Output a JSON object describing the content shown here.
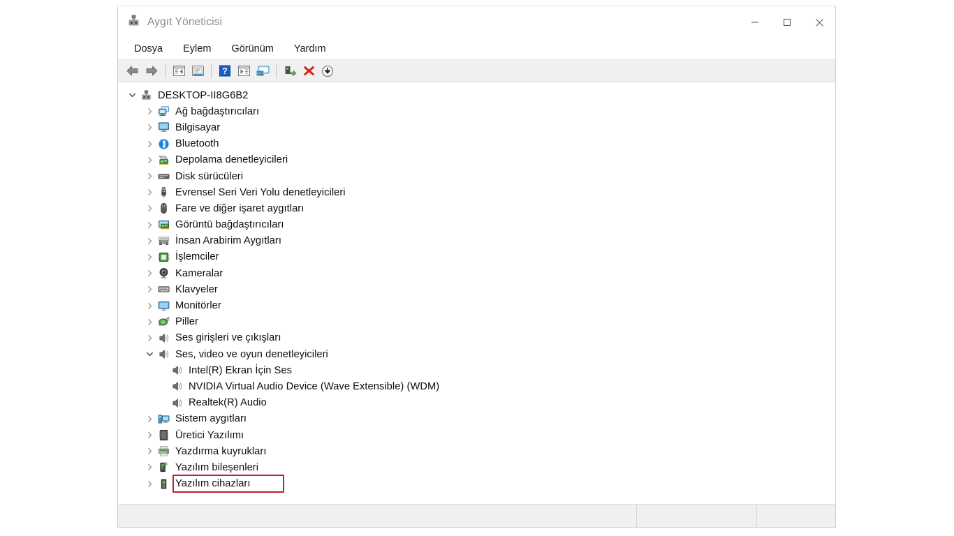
{
  "window": {
    "title": "Aygıt Yöneticisi",
    "icon": "device-manager-icon",
    "controls": {
      "minimize": "minimize-icon",
      "maximize": "maximize-icon",
      "close": "close-icon"
    }
  },
  "menubar": {
    "items": [
      {
        "label": "Dosya"
      },
      {
        "label": "Eylem"
      },
      {
        "label": "Görünüm"
      },
      {
        "label": "Yardım"
      }
    ]
  },
  "toolbar": {
    "buttons": [
      {
        "icon": "back-arrow-icon",
        "title": "Geri"
      },
      {
        "icon": "forward-arrow-icon",
        "title": "İleri"
      },
      {
        "icon": "separator"
      },
      {
        "icon": "properties-panel-icon",
        "title": "Özellikler"
      },
      {
        "icon": "help-document-icon",
        "title": "Yardım"
      },
      {
        "icon": "separator"
      },
      {
        "icon": "help-question-icon",
        "title": "Yardım"
      },
      {
        "icon": "show-hidden-devices-icon",
        "title": "Gizli aygıtları göster"
      },
      {
        "icon": "scan-hardware-icon",
        "title": "Donanım değişikliklerini tara"
      },
      {
        "icon": "separator"
      },
      {
        "icon": "update-driver-icon",
        "title": "Sürücüyü güncelle"
      },
      {
        "icon": "uninstall-device-icon",
        "title": "Aygıtı kaldır"
      },
      {
        "icon": "download-driver-icon",
        "title": "Sürücü indir"
      }
    ]
  },
  "tree": {
    "root": {
      "label": "DESKTOP-II8G6B2",
      "icon": "computer-root-icon",
      "expanded": true
    },
    "nodes": [
      {
        "label": "Ağ bağdaştırıcıları",
        "icon": "network-adapter-icon",
        "expanded": false,
        "depth": 1
      },
      {
        "label": "Bilgisayar",
        "icon": "computer-icon",
        "expanded": false,
        "depth": 1
      },
      {
        "label": "Bluetooth",
        "icon": "bluetooth-icon",
        "expanded": false,
        "depth": 1
      },
      {
        "label": "Depolama denetleyicileri",
        "icon": "storage-controller-icon",
        "expanded": false,
        "depth": 1
      },
      {
        "label": "Disk sürücüleri",
        "icon": "disk-drive-icon",
        "expanded": false,
        "depth": 1
      },
      {
        "label": "Evrensel Seri Veri Yolu denetleyicileri",
        "icon": "usb-controller-icon",
        "expanded": false,
        "depth": 1
      },
      {
        "label": "Fare ve diğer işaret aygıtları",
        "icon": "mouse-icon",
        "expanded": false,
        "depth": 1
      },
      {
        "label": "Görüntü bağdaştırıcıları",
        "icon": "display-adapter-icon",
        "expanded": false,
        "depth": 1
      },
      {
        "label": "İnsan Arabirim Aygıtları",
        "icon": "hid-device-icon",
        "expanded": false,
        "depth": 1
      },
      {
        "label": "İşlemciler",
        "icon": "processor-icon",
        "expanded": false,
        "depth": 1
      },
      {
        "label": "Kameralar",
        "icon": "camera-icon",
        "expanded": false,
        "depth": 1
      },
      {
        "label": "Klavyeler",
        "icon": "keyboard-icon",
        "expanded": false,
        "depth": 1
      },
      {
        "label": "Monitörler",
        "icon": "monitor-icon",
        "expanded": false,
        "depth": 1
      },
      {
        "label": "Piller",
        "icon": "battery-icon",
        "expanded": false,
        "depth": 1
      },
      {
        "label": "Ses girişleri ve çıkışları",
        "icon": "speaker-icon",
        "expanded": false,
        "depth": 1
      },
      {
        "label": "Ses, video ve oyun denetleyicileri",
        "icon": "speaker-icon",
        "expanded": true,
        "depth": 1
      },
      {
        "label": "Intel(R) Ekran İçin Ses",
        "icon": "speaker-icon",
        "expanded": null,
        "depth": 2
      },
      {
        "label": "NVIDIA Virtual Audio Device (Wave Extensible) (WDM)",
        "icon": "speaker-icon",
        "expanded": null,
        "depth": 2
      },
      {
        "label": "Realtek(R) Audio",
        "icon": "speaker-icon",
        "expanded": null,
        "depth": 2,
        "highlighted": true
      },
      {
        "label": "Sistem aygıtları",
        "icon": "system-device-icon",
        "expanded": false,
        "depth": 1
      },
      {
        "label": "Üretici Yazılımı",
        "icon": "firmware-icon",
        "expanded": false,
        "depth": 1
      },
      {
        "label": "Yazdırma kuyrukları",
        "icon": "print-queue-icon",
        "expanded": false,
        "depth": 1
      },
      {
        "label": "Yazılım bileşenleri",
        "icon": "software-component-icon",
        "expanded": false,
        "depth": 1
      },
      {
        "label": "Yazılım cihazları",
        "icon": "software-device-icon",
        "expanded": false,
        "depth": 1
      }
    ]
  },
  "statusbar": {
    "pane1": "",
    "pane2": "",
    "pane3": ""
  },
  "colors": {
    "highlight": "#c0202a",
    "title_text": "#8b8b8b",
    "toolbar_bg": "#f0f0f0",
    "tree_text": "#0d0d0d"
  }
}
